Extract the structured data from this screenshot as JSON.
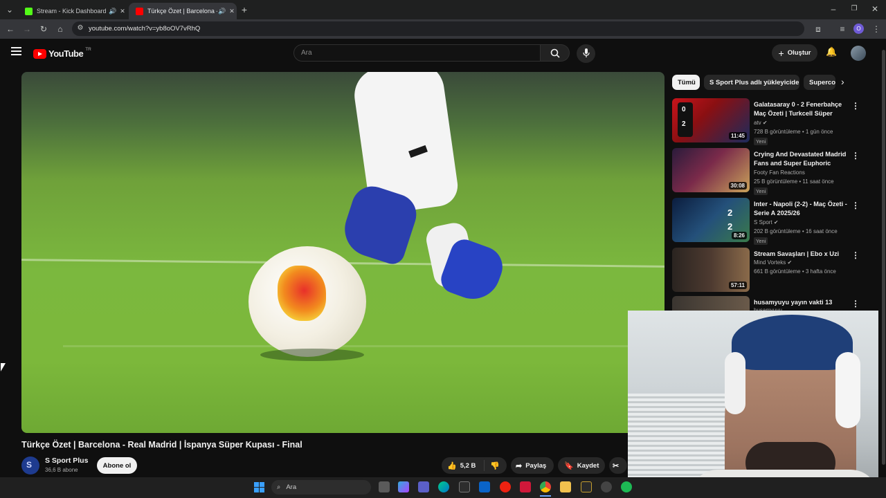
{
  "browser": {
    "tabs": [
      {
        "title": "Stream - Kick Dashboard",
        "active": false
      },
      {
        "title": "Türkçe Özet | Barcelona - Re",
        "active": true
      }
    ],
    "url": "youtube.com/watch?v=yb8oOV7vRhQ"
  },
  "youtube": {
    "logo_text": "YouTube",
    "region": "TR",
    "search_placeholder": "Ara",
    "create_label": "Oluştur"
  },
  "video": {
    "title": "Türkçe Özet | Barcelona - Real Madrid | İspanya Süper Kupası - Final",
    "channel": "S Sport Plus",
    "subscribers": "36,6 B abone",
    "subscribe_label": "Abone ol",
    "likes": "5,2 B",
    "share_label": "Paylaş",
    "save_label": "Kaydet"
  },
  "chips": [
    "Tümü",
    "S Sport Plus adlı yükleyiciden",
    "Superco"
  ],
  "recommendations": [
    {
      "title": "Galatasaray 0 - 2 Fenerbahçe Maç Özeti | Turkcell Süper Kup...",
      "channel": "atv",
      "meta": "728 B görüntüleme • 1 gün önce",
      "badge": "Yeni",
      "duration": "11:45",
      "thumb_color": "#a31616"
    },
    {
      "title": "Crying And Devastated Madrid Fans and Super Euphoric Barc...",
      "channel": "Footy Fan Reactions",
      "meta": "25 B görüntüleme • 11 saat önce",
      "badge": "Yeni",
      "duration": "30:08",
      "thumb_color": "#6a2f5a"
    },
    {
      "title": "Inter - Napoli (2-2) - Maç Özeti - Serie A 2025/26",
      "channel": "S Sport",
      "meta": "202 B görüntüleme • 16 saat önce",
      "badge": "Yeni",
      "duration": "8:26",
      "thumb_color": "#1a3a78"
    },
    {
      "title": "Stream Savaşları | Ebo x Uzi",
      "channel": "Mind Vorteks",
      "meta": "661 B görüntüleme • 3 hafta önce",
      "badge": "",
      "duration": "57:11",
      "thumb_color": "#3a2a22"
    },
    {
      "title": "husamyuyu yayın vakti 13",
      "channel": "husamyuyu",
      "meta": "",
      "badge": "",
      "duration": "",
      "thumb_color": "#5a5048"
    }
  ],
  "taskbar": {
    "search_label": "Ara"
  },
  "colors": {
    "youtube_red": "#ff0000",
    "kick_green": "#53fc18",
    "background": "#0f0f0f"
  }
}
